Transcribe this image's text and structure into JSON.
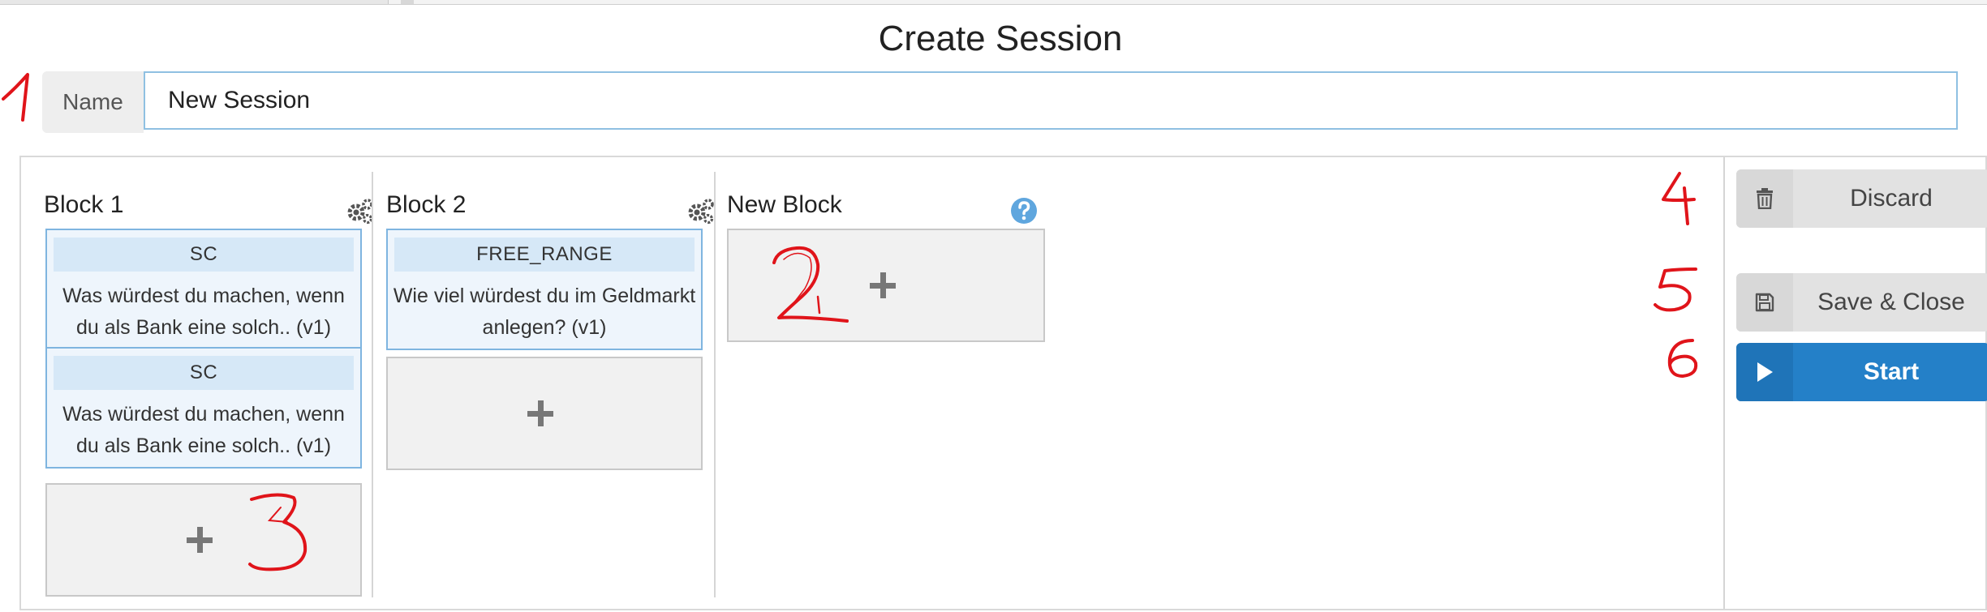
{
  "page": {
    "title": "Create Session"
  },
  "name_field": {
    "label": "Name",
    "value": "New Session"
  },
  "blocks": [
    {
      "title": "Block 1",
      "icon": "gears-icon",
      "cards": [
        {
          "type": "SC",
          "text": "Was würdest du machen, wenn du als Bank eine solch.. (v1)"
        },
        {
          "type": "SC",
          "text": "Was würdest du machen, wenn du als Bank eine solch.. (v1)"
        }
      ]
    },
    {
      "title": "Block 2",
      "icon": "gears-icon",
      "cards": [
        {
          "type": "FREE_RANGE",
          "text": "Wie viel würdest du im Geldmarkt anlegen? (v1)"
        }
      ]
    },
    {
      "title": "New Block",
      "icon": "help-icon",
      "cards": []
    }
  ],
  "actions": {
    "discard": {
      "label": "Discard",
      "icon": "trash-icon"
    },
    "save_close": {
      "label": "Save & Close",
      "icon": "floppy-disk-icon"
    },
    "start": {
      "label": "Start",
      "icon": "play-icon"
    }
  },
  "annotations": [
    "1",
    "2",
    "3",
    "4",
    "5",
    "6"
  ],
  "colors": {
    "accent_blue": "#2480c8",
    "card_border": "#7fb5e0",
    "card_bg": "#eef5fc",
    "annotation_red": "#e0141a"
  }
}
